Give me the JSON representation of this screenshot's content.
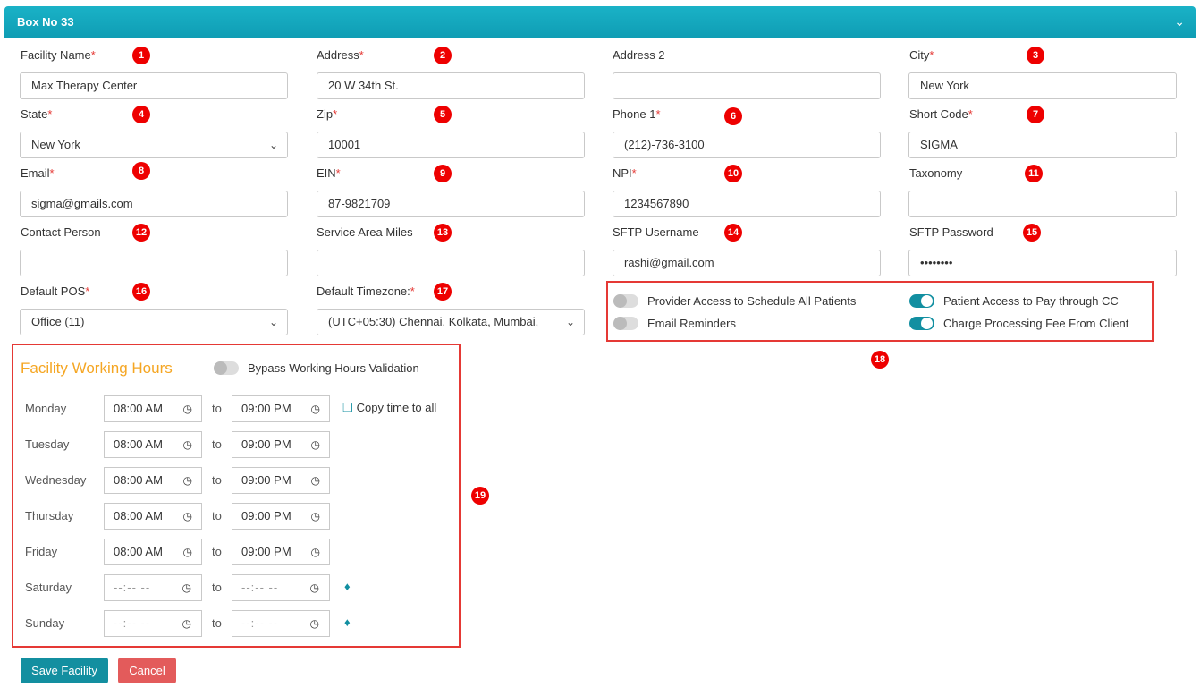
{
  "header": {
    "title": "Box No 33"
  },
  "badges": [
    "1",
    "2",
    "3",
    "4",
    "5",
    "6",
    "7",
    "8",
    "9",
    "10",
    "11",
    "12",
    "13",
    "14",
    "15",
    "16",
    "17",
    "18",
    "19"
  ],
  "fields": {
    "facility_name": {
      "label": "Facility Name",
      "value": "Max Therapy Center"
    },
    "address": {
      "label": "Address",
      "value": "20 W 34th St."
    },
    "address2": {
      "label": "Address 2",
      "value": ""
    },
    "city": {
      "label": "City",
      "value": "New York"
    },
    "state": {
      "label": "State",
      "value": "New York"
    },
    "zip": {
      "label": "Zip",
      "value": "10001"
    },
    "phone1": {
      "label": "Phone 1",
      "value": "(212)-736-3100"
    },
    "short_code": {
      "label": "Short Code",
      "value": "SIGMA"
    },
    "email": {
      "label": "Email",
      "value": "sigma@gmails.com"
    },
    "ein": {
      "label": "EIN",
      "value": "87-9821709"
    },
    "npi": {
      "label": "NPI",
      "value": "1234567890"
    },
    "taxonomy": {
      "label": "Taxonomy",
      "value": ""
    },
    "contact_person": {
      "label": "Contact Person",
      "value": ""
    },
    "service_area": {
      "label": "Service Area Miles",
      "value": ""
    },
    "sftp_username": {
      "label": "SFTP Username",
      "value": "rashi@gmail.com"
    },
    "sftp_password": {
      "label": "SFTP Password",
      "value": "••••••••"
    },
    "default_pos": {
      "label": "Default POS",
      "value": "Office (11)"
    },
    "default_timezone": {
      "label": "Default Timezone:",
      "value": "(UTC+05:30) Chennai, Kolkata, Mumbai,"
    }
  },
  "required_mark": "*",
  "toggles": {
    "provider_access": {
      "label": "Provider Access to Schedule All Patients",
      "on": false
    },
    "patient_access": {
      "label": "Patient Access to Pay through CC",
      "on": true
    },
    "email_reminders": {
      "label": "Email Reminders",
      "on": false
    },
    "charge_fee": {
      "label": "Charge Processing Fee From Client",
      "on": true
    },
    "bypass": {
      "label": "Bypass Working Hours Validation",
      "on": false
    }
  },
  "working_hours": {
    "title": "Facility Working Hours",
    "to_label": "to",
    "copy_label": "Copy time to all",
    "days": [
      {
        "name": "Monday",
        "from": "08:00 AM",
        "to": "09:00 PM"
      },
      {
        "name": "Tuesday",
        "from": "08:00 AM",
        "to": "09:00 PM"
      },
      {
        "name": "Wednesday",
        "from": "08:00 AM",
        "to": "09:00 PM"
      },
      {
        "name": "Thursday",
        "from": "08:00 AM",
        "to": "09:00 PM"
      },
      {
        "name": "Friday",
        "from": "08:00 AM",
        "to": "09:00 PM"
      },
      {
        "name": "Saturday",
        "from": "--:-- --",
        "to": "--:-- --"
      },
      {
        "name": "Sunday",
        "from": "--:-- --",
        "to": "--:-- --"
      }
    ]
  },
  "buttons": {
    "save": "Save Facility",
    "cancel": "Cancel"
  },
  "icons": {
    "chevron": "chevron-down-icon",
    "clock": "clock-icon",
    "copy": "copy-icon",
    "eraser": "eraser-icon"
  }
}
